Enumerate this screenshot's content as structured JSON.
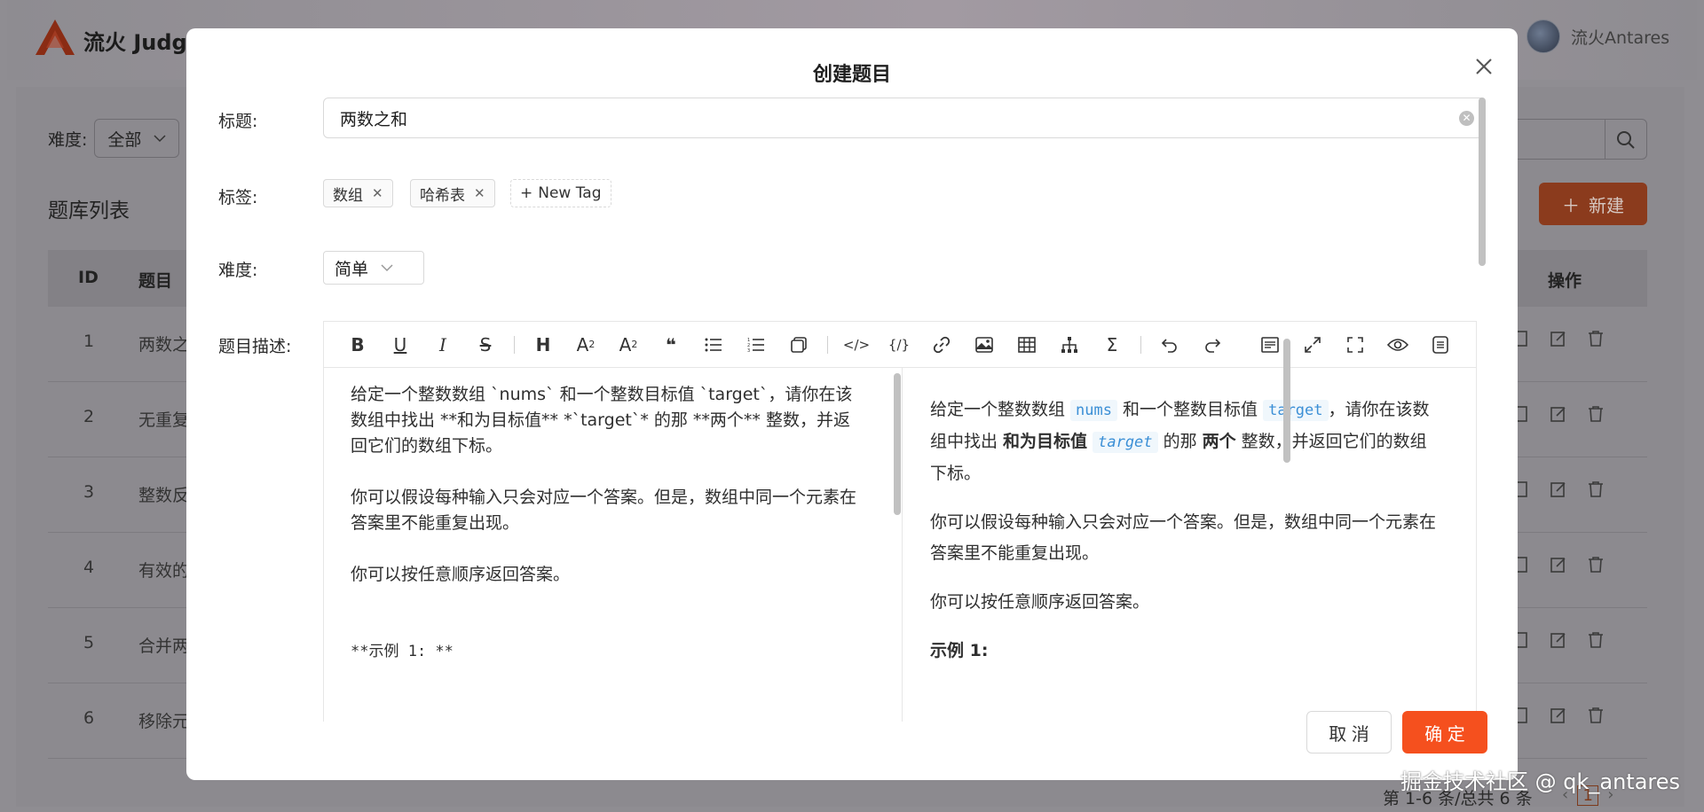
{
  "app": {
    "name": "流火 Judge",
    "user_name": "流火Antares"
  },
  "background": {
    "filter_label": "难度:",
    "filter_value": "全部",
    "list_title": "题库列表",
    "new_button": "新建",
    "columns": {
      "id": "ID",
      "title": "题目",
      "actions": "操作"
    },
    "rows": [
      {
        "id": "1",
        "title": "两数之和"
      },
      {
        "id": "2",
        "title": "无重复"
      },
      {
        "id": "3",
        "title": "整数反"
      },
      {
        "id": "4",
        "title": "有效的"
      },
      {
        "id": "5",
        "title": "合并两"
      },
      {
        "id": "6",
        "title": "移除元"
      }
    ],
    "pagination_text": "第 1-6 条/总共 6 条",
    "current_page": "1",
    "watermark": "掘金技术社区 @ qk_antares"
  },
  "modal": {
    "title": "创建题目",
    "labels": {
      "title": "标题:",
      "tags": "标签:",
      "difficulty": "难度:",
      "description": "题目描述:"
    },
    "title_value": "两数之和",
    "tags": [
      "数组",
      "哈希表"
    ],
    "new_tag": "New Tag",
    "difficulty_value": "简单",
    "editor_source": {
      "p1a": "给定一个整数数组 `nums` 和一个整数目标值 `target`，请你在该数组中找出 **和为目标值** *`target`* 的那 **两个** 整数，并返回它们的数组下标。",
      "p2": "你可以假设每种输入只会对应一个答案。但是，数组中同一个元素在答案里不能重复出现。",
      "p3": "你可以按任意顺序返回答案。",
      "p4": "**示例 1: **"
    },
    "preview": {
      "p1_a": "给定一个整数数组 ",
      "code_nums": "nums",
      "p1_b": " 和一个整数目标值 ",
      "code_target": "target",
      "p1_c": "，请你在该数组中找出 ",
      "bold_target": "和为目标值",
      "code_target2": "target",
      "p1_d": " 的那 ",
      "bold_two": "两个",
      "p1_e": " 整数，并返回它们的数组下标。",
      "p2": "你可以假设每种输入只会对应一个答案。但是，数组中同一个元素在答案里不能重复出现。",
      "p3": "你可以按任意顺序返回答案。",
      "p4": "示例 1:"
    },
    "cancel": "取 消",
    "ok": "确 定"
  },
  "colors": {
    "primary": "#f5501e",
    "code_text": "#3b8fd6",
    "code_bg": "#f0f7fc"
  }
}
